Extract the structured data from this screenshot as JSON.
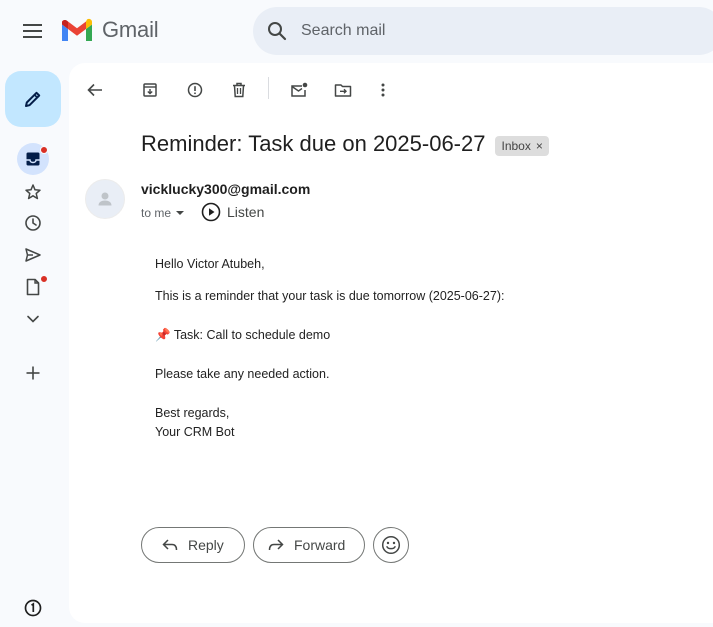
{
  "app": {
    "logo_text": "Gmail",
    "brand_colors": {
      "red": "#ea4335",
      "blue": "#4285f4",
      "green": "#34a853",
      "yellow": "#fbbc04"
    }
  },
  "search": {
    "placeholder": "Search mail"
  },
  "rail": {
    "items": [
      {
        "icon": "inbox-icon",
        "active": true,
        "has_dot": true
      },
      {
        "icon": "star-icon",
        "active": false,
        "has_dot": false
      },
      {
        "icon": "clock-icon",
        "active": false,
        "has_dot": false
      },
      {
        "icon": "send-icon",
        "active": false,
        "has_dot": false
      },
      {
        "icon": "draft-icon",
        "active": false,
        "has_dot": true
      },
      {
        "icon": "chevron-down-icon",
        "active": false,
        "has_dot": false
      },
      {
        "icon": "plus-icon",
        "active": false,
        "has_dot": false
      }
    ]
  },
  "toolbar": {
    "icons": [
      "back-arrow-icon",
      "archive-icon",
      "report-spam-icon",
      "delete-icon",
      "mark-unread-icon",
      "move-to-icon",
      "more-vert-icon"
    ]
  },
  "email": {
    "subject": "Reminder: Task due on 2025-06-27",
    "label": "Inbox",
    "label_close": "×",
    "sender": "vicklucky300@gmail.com",
    "to": "to me",
    "listen": "Listen",
    "body": {
      "greeting": "Hello Victor Atubeh,",
      "line1": "This is a reminder that your task is due tomorrow (2025-06-27):",
      "task_emoji": "📌",
      "task": "Task: Call to schedule demo",
      "line2": "Please take any needed action.",
      "closing": "Best regards,",
      "signature": "Your CRM Bot"
    }
  },
  "actions": {
    "reply": "Reply",
    "forward": "Forward"
  }
}
